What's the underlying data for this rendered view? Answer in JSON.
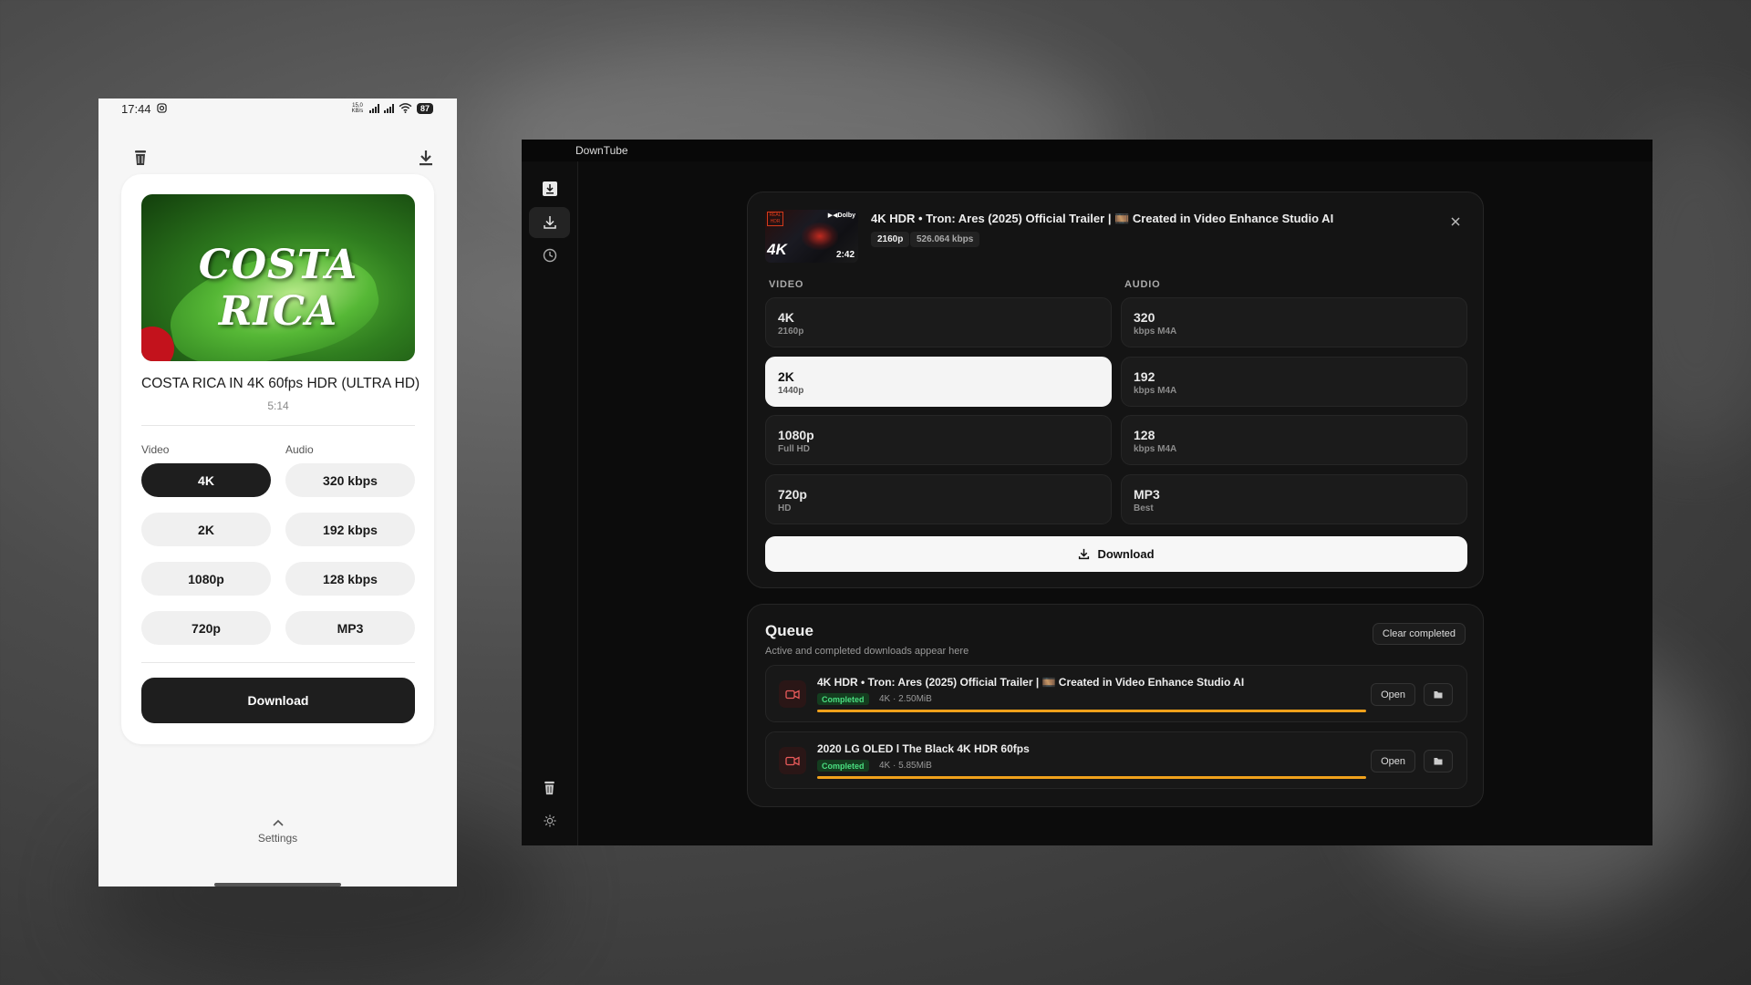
{
  "colors": {
    "accent_progress": "#f0a11b",
    "completed_green": "#4ade80",
    "hdr_red": "#d53a1b"
  },
  "phone": {
    "status": {
      "time": "17:44",
      "net_speed": "15,0 KB/s",
      "battery": "87"
    },
    "icons": {
      "top_left": "trash-icon",
      "top_right": "download-icon"
    },
    "video": {
      "thumbnail_text": "COSTA RICA",
      "title": "COSTA RICA IN 4K 60fps HDR (ULTRA HD)",
      "duration": "5:14"
    },
    "video_label": "Video",
    "audio_label": "Audio",
    "video_options": [
      "4K",
      "2K",
      "1080p",
      "720p"
    ],
    "audio_options": [
      "320 kbps",
      "192 kbps",
      "128 kbps",
      "MP3"
    ],
    "selected_video": "4K",
    "download_label": "Download",
    "settings_label": "Settings"
  },
  "desktop": {
    "app_title": "DownTube",
    "sidebar": {
      "items": [
        "logo-icon",
        "download-icon",
        "history-icon",
        "trash-icon",
        "settings-icon"
      ]
    },
    "current": {
      "title": "4K HDR • Tron: Ares (2025) Official Trailer | 🎞️ Created in Video Enhance Studio AI",
      "duration": "2:42",
      "thumb_badge": "4K",
      "thumb_hdr": "REAL HDR",
      "thumb_dolby": "▶◀Dolby",
      "resolution_chip": "2160p",
      "bitrate_chip": "526.064 kbps"
    },
    "video_label": "VIDEO",
    "audio_label": "AUDIO",
    "video_options": [
      {
        "title": "4K",
        "sub": "2160p"
      },
      {
        "title": "2K",
        "sub": "1440p"
      },
      {
        "title": "1080p",
        "sub": "Full HD"
      },
      {
        "title": "720p",
        "sub": "HD"
      }
    ],
    "audio_options": [
      {
        "title": "320",
        "sub": "kbps M4A"
      },
      {
        "title": "192",
        "sub": "kbps M4A"
      },
      {
        "title": "128",
        "sub": "kbps M4A"
      },
      {
        "title": "MP3",
        "sub": "Best"
      }
    ],
    "selected_video": "2K",
    "download_label": "Download",
    "queue": {
      "title": "Queue",
      "subtitle": "Active and completed downloads appear here",
      "clear_label": "Clear completed",
      "items": [
        {
          "name": "4K HDR • Tron: Ares (2025) Official Trailer | 🎞️ Created in Video Enhance Studio AI",
          "status": "Completed",
          "meta": "4K · 2.50MiB",
          "progress": 1.0,
          "open_label": "Open"
        },
        {
          "name": "2020 LG OLED l The Black 4K HDR 60fps",
          "status": "Completed",
          "meta": "4K · 5.85MiB",
          "progress": 1.0,
          "open_label": "Open"
        }
      ]
    }
  }
}
